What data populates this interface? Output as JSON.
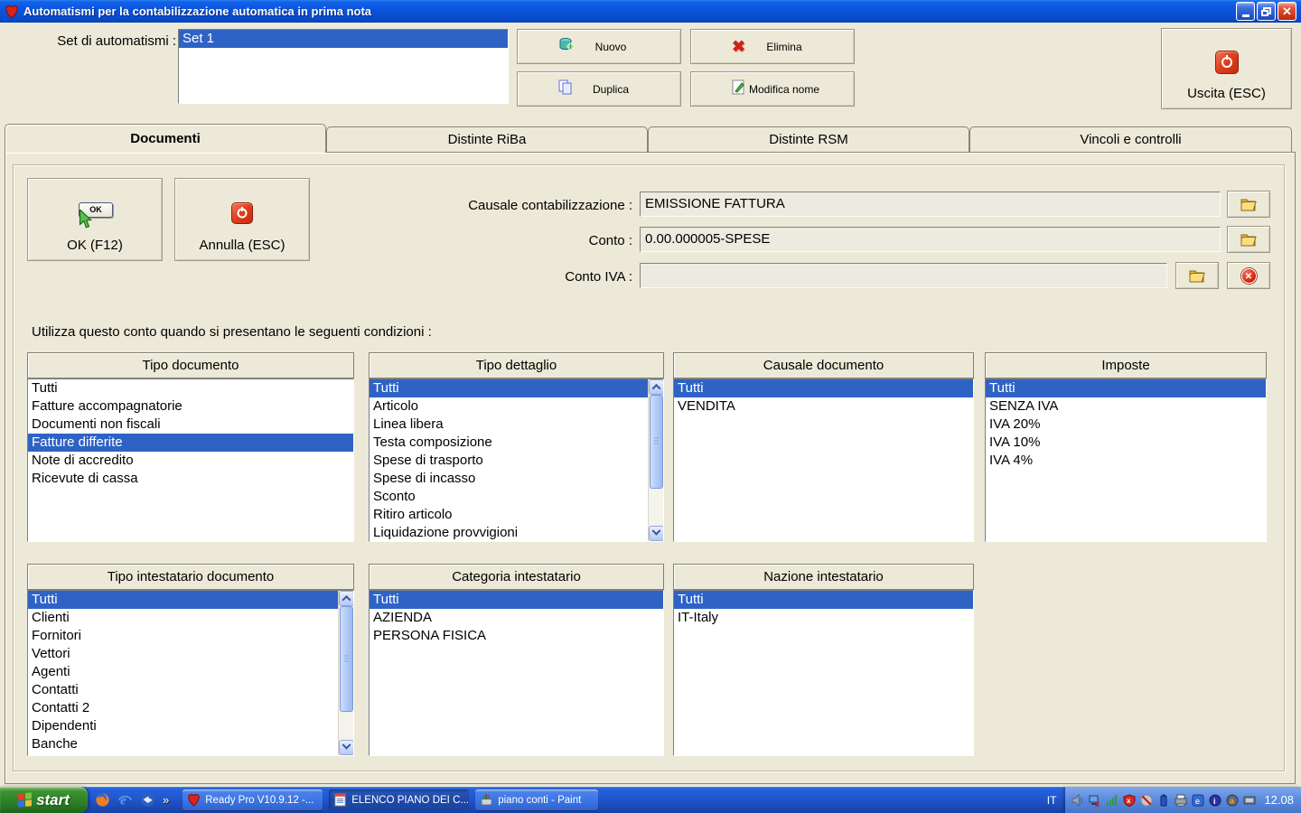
{
  "window": {
    "title": "Automatismi per la contabilizzazione automatica in prima nota"
  },
  "header": {
    "set_label": "Set di automatismi :",
    "set_items": [
      "Set 1"
    ],
    "set_selected_index": 0,
    "nuovo_label": "Nuovo",
    "elimina_label": "Elimina",
    "duplica_label": "Duplica",
    "modifica_nome_label": "Modifica nome",
    "uscita_label": "Uscita (ESC)"
  },
  "tabs": [
    {
      "label": "Documenti",
      "active": true
    },
    {
      "label": "Distinte RiBa",
      "active": false
    },
    {
      "label": "Distinte RSM",
      "active": false
    },
    {
      "label": "Vincoli e controlli",
      "active": false
    }
  ],
  "form": {
    "ok_label": "OK (F12)",
    "ok_icon_text": "OK",
    "annulla_label": "Annulla (ESC)",
    "causale_label": "Causale contabilizzazione :",
    "causale_value": "EMISSIONE FATTURA",
    "conto_label": "Conto :",
    "conto_value": "0.00.000005-SPESE",
    "conto_iva_label": "Conto IVA :",
    "conto_iva_value": "",
    "condizioni_text": "Utilizza questo conto quando si presentano le seguenti condizioni :"
  },
  "condition_lists": [
    {
      "title": "Tipo documento",
      "selected_index": 3,
      "scrollbar": false,
      "items": [
        "Tutti",
        "Fatture accompagnatorie",
        "Documenti non fiscali",
        "Fatture differite",
        "Note di accredito",
        "Ricevute di cassa"
      ]
    },
    {
      "title": "Tipo dettaglio",
      "selected_index": 0,
      "scrollbar": true,
      "thumb_fraction": 0.72,
      "items": [
        "Tutti",
        "Articolo",
        "Linea libera",
        "Testa composizione",
        "Spese di trasporto",
        "Spese di incasso",
        "Sconto",
        "Ritiro articolo",
        "Liquidazione provvigioni"
      ]
    },
    {
      "title": "Causale documento",
      "selected_index": 0,
      "scrollbar": false,
      "items": [
        "Tutti",
        "VENDITA"
      ]
    },
    {
      "title": "Imposte",
      "selected_index": 0,
      "scrollbar": false,
      "items": [
        "Tutti",
        "SENZA IVA",
        "IVA 20%",
        "IVA 10%",
        "IVA 4%"
      ]
    },
    {
      "title": "Tipo intestatario documento",
      "selected_index": 0,
      "scrollbar": true,
      "thumb_fraction": 0.79,
      "items": [
        "Tutti",
        "Clienti",
        "Fornitori",
        "Vettori",
        "Agenti",
        "Contatti",
        "Contatti 2",
        "Dipendenti",
        "Banche"
      ]
    },
    {
      "title": "Categoria intestatario",
      "selected_index": 0,
      "scrollbar": false,
      "items": [
        "Tutti",
        "AZIENDA",
        "PERSONA FISICA"
      ]
    },
    {
      "title": "Nazione intestatario",
      "selected_index": 0,
      "scrollbar": false,
      "items": [
        "Tutti",
        "IT-Italy"
      ]
    }
  ],
  "taskbar": {
    "start_label": "start",
    "chevron": "»",
    "tasks": [
      {
        "label": "Ready Pro V10.9.12 -..."
      },
      {
        "label": "ELENCO PIANO DEI C..."
      },
      {
        "label": "piano conti - Paint"
      }
    ],
    "language": "IT",
    "time": "12.08"
  },
  "colors": {
    "selection_blue": "#2E63C5",
    "window_face": "#ECE9D8",
    "titlebar_blue": "#0b54df",
    "taskbar_blue": "#1941A5",
    "start_green": "#2f8428"
  }
}
